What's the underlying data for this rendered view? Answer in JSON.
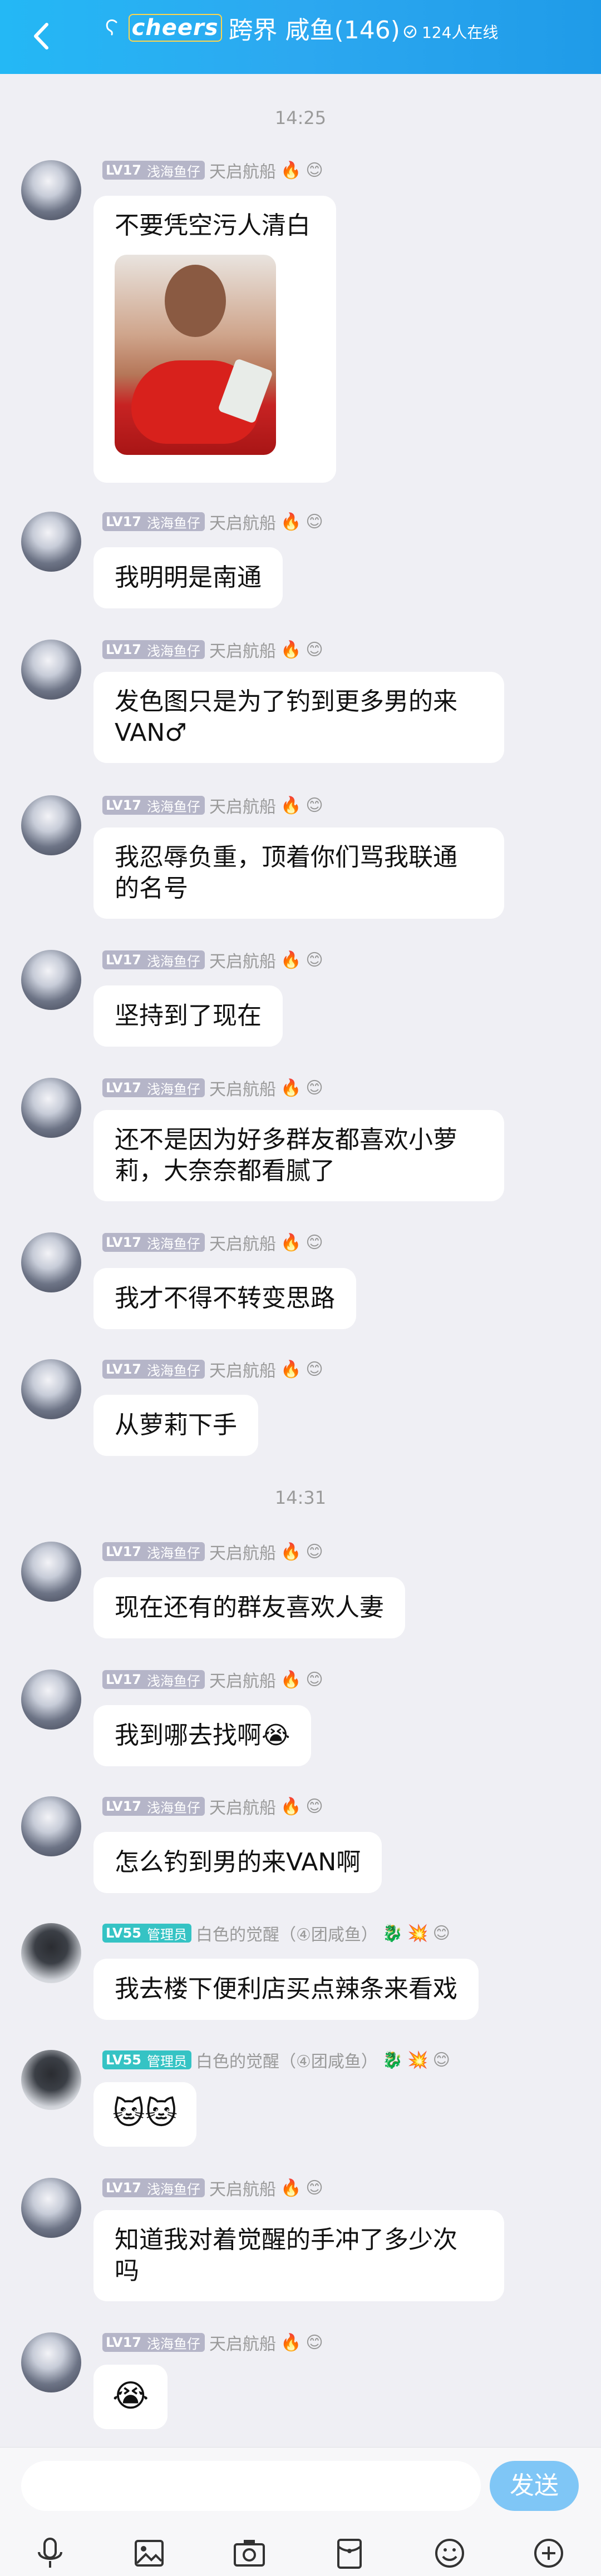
{
  "header": {
    "brand": "cheers",
    "title": "跨界 咸鱼(146)",
    "online": "124人在线"
  },
  "users": {
    "a": {
      "level": "LV17",
      "nick": "浅海鱼仔",
      "group": "天启航船"
    },
    "b": {
      "level": "LV55",
      "nick": "管理员",
      "group": "白色的觉醒（④团咸鱼）"
    }
  },
  "times": [
    "14:25",
    "14:31"
  ],
  "messages": [
    "不要凭空污人清白",
    "我明明是南通",
    "发色图只是为了钓到更多男的来",
    "VAN♂",
    "我忍辱负重，顶着你们骂我联通",
    "的名号",
    "坚持到了现在",
    "还不是因为好多群友都喜欢小萝",
    "莉，大奈奈都看腻了",
    "我才不得不转变思路",
    "从萝莉下手",
    "现在还有的群友喜欢人妻",
    "我到哪去找啊😭",
    "怎么钓到男的来VAN啊",
    "我去楼下便利店买点辣条来看戏",
    "🐱🐱",
    "知道我对着觉醒的手冲了多少次",
    "吗",
    "😭"
  ],
  "input": {
    "send": "发送"
  }
}
